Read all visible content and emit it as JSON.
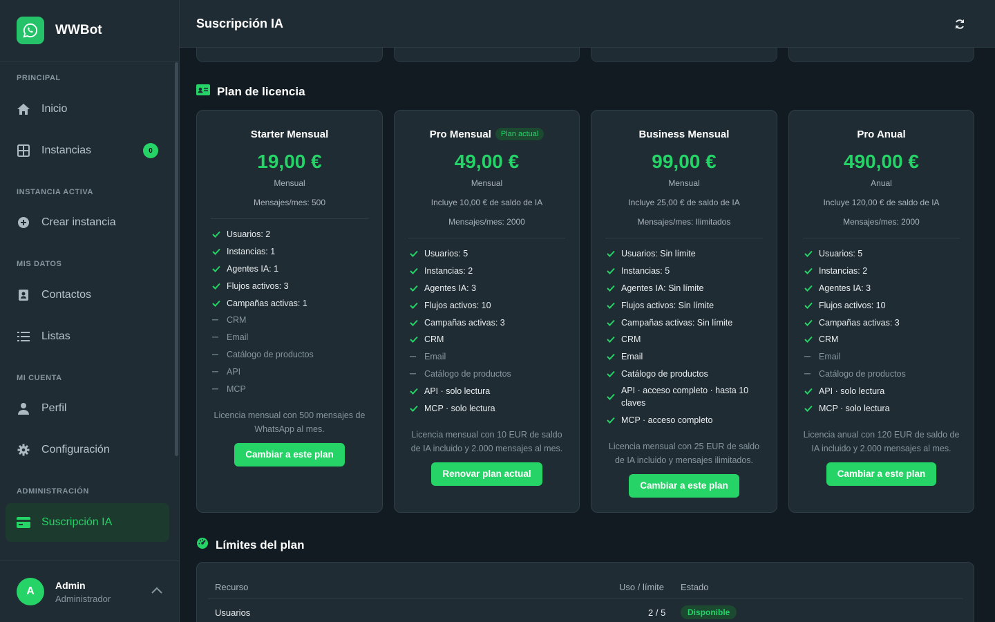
{
  "app": {
    "name": "WWBot"
  },
  "header": {
    "title": "Suscripción IA"
  },
  "sidebar": {
    "sections": {
      "principal": "PRINCIPAL",
      "instancia": "INSTANCIA ACTIVA",
      "datos": "MIS DATOS",
      "cuenta": "MI CUENTA",
      "admin": "ADMINISTRACIÓN"
    },
    "items": {
      "inicio": "Inicio",
      "instancias": "Instancias",
      "instancias_badge": "0",
      "crear": "Crear instancia",
      "contactos": "Contactos",
      "listas": "Listas",
      "perfil": "Perfil",
      "config": "Configuración",
      "suscripcion": "Suscripción IA"
    },
    "user": {
      "initial": "A",
      "name": "Admin",
      "role": "Administrador"
    }
  },
  "plans_section": {
    "title": "Plan de licencia"
  },
  "plans": [
    {
      "name": "Starter Mensual",
      "tag": "",
      "price": "19,00 €",
      "period": "Mensual",
      "meta1": "Mensajes/mes: 500",
      "meta2": "",
      "features": [
        {
          "t": "Usuarios: 2",
          "on": true
        },
        {
          "t": "Instancias: 1",
          "on": true
        },
        {
          "t": "Agentes IA: 1",
          "on": true
        },
        {
          "t": "Flujos activos: 3",
          "on": true
        },
        {
          "t": "Campañas activas: 1",
          "on": true
        },
        {
          "t": "CRM",
          "on": false
        },
        {
          "t": "Email",
          "on": false
        },
        {
          "t": "Catálogo de productos",
          "on": false
        },
        {
          "t": "API",
          "on": false
        },
        {
          "t": "MCP",
          "on": false
        }
      ],
      "desc": "Licencia mensual con 500 mensajes de WhatsApp al mes.",
      "button": "Cambiar a este plan"
    },
    {
      "name": "Pro Mensual",
      "tag": "Plan actual",
      "price": "49,00 €",
      "period": "Mensual",
      "meta1": "Incluye 10,00 € de saldo de IA",
      "meta2": "Mensajes/mes: 2000",
      "features": [
        {
          "t": "Usuarios: 5",
          "on": true
        },
        {
          "t": "Instancias: 2",
          "on": true
        },
        {
          "t": "Agentes IA: 3",
          "on": true
        },
        {
          "t": "Flujos activos: 10",
          "on": true
        },
        {
          "t": "Campañas activas: 3",
          "on": true
        },
        {
          "t": "CRM",
          "on": true
        },
        {
          "t": "Email",
          "on": false
        },
        {
          "t": "Catálogo de productos",
          "on": false
        },
        {
          "t": "API · solo lectura",
          "on": true
        },
        {
          "t": "MCP · solo lectura",
          "on": true
        }
      ],
      "desc": "Licencia mensual con 10 EUR de saldo de IA incluido y 2.000 mensajes al mes.",
      "button": "Renovar plan actual"
    },
    {
      "name": "Business Mensual",
      "tag": "",
      "price": "99,00 €",
      "period": "Mensual",
      "meta1": "Incluye 25,00 € de saldo de IA",
      "meta2": "Mensajes/mes: Ilimitados",
      "features": [
        {
          "t": "Usuarios: Sin límite",
          "on": true
        },
        {
          "t": "Instancias: 5",
          "on": true
        },
        {
          "t": "Agentes IA: Sin límite",
          "on": true
        },
        {
          "t": "Flujos activos: Sin límite",
          "on": true
        },
        {
          "t": "Campañas activas: Sin límite",
          "on": true
        },
        {
          "t": "CRM",
          "on": true
        },
        {
          "t": "Email",
          "on": true
        },
        {
          "t": "Catálogo de productos",
          "on": true
        },
        {
          "t": "API · acceso completo · hasta 10 claves",
          "on": true
        },
        {
          "t": "MCP · acceso completo",
          "on": true
        }
      ],
      "desc": "Licencia mensual con 25 EUR de saldo de IA incluido y mensajes ilimitados.",
      "button": "Cambiar a este plan"
    },
    {
      "name": "Pro Anual",
      "tag": "",
      "price": "490,00 €",
      "period": "Anual",
      "meta1": "Incluye 120,00 € de saldo de IA",
      "meta2": "Mensajes/mes: 2000",
      "features": [
        {
          "t": "Usuarios: 5",
          "on": true
        },
        {
          "t": "Instancias: 2",
          "on": true
        },
        {
          "t": "Agentes IA: 3",
          "on": true
        },
        {
          "t": "Flujos activos: 10",
          "on": true
        },
        {
          "t": "Campañas activas: 3",
          "on": true
        },
        {
          "t": "CRM",
          "on": true
        },
        {
          "t": "Email",
          "on": false
        },
        {
          "t": "Catálogo de productos",
          "on": false
        },
        {
          "t": "API · solo lectura",
          "on": true
        },
        {
          "t": "MCP · solo lectura",
          "on": true
        }
      ],
      "desc": "Licencia anual con 120 EUR de saldo de IA incluido y 2.000 mensajes al mes.",
      "button": "Cambiar a este plan"
    }
  ],
  "limits": {
    "title": "Límites del plan",
    "headers": {
      "resource": "Recurso",
      "usage": "Uso / límite",
      "status": "Estado"
    },
    "rows": [
      {
        "resource": "Usuarios",
        "usage": "2 / 5",
        "status": "Disponible"
      }
    ]
  },
  "colors": {
    "accent": "#25d366",
    "bg": "#111b21",
    "panel": "#1f2c33"
  }
}
